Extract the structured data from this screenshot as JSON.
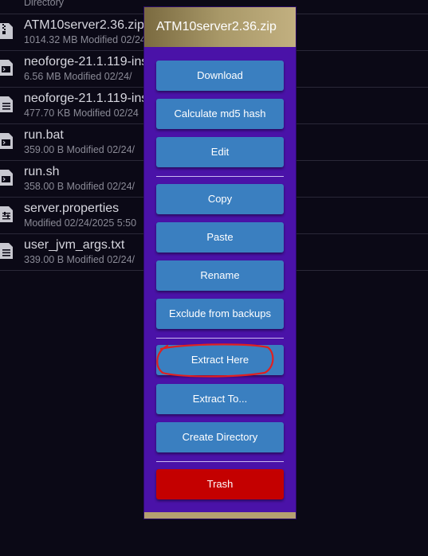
{
  "files": [
    {
      "name": "",
      "meta": "Directory",
      "icon": "folder-icon"
    },
    {
      "name": "ATM10server2.36.zip",
      "meta": "1014.32 MB Modified 02/24/",
      "icon": "zip-file-icon"
    },
    {
      "name": "neoforge-21.1.119-ins",
      "meta": "6.56 MB Modified 02/24/",
      "icon": "terminal-file-icon"
    },
    {
      "name": "neoforge-21.1.119-ins",
      "meta": "477.70 KB Modified 02/24",
      "icon": "document-file-icon"
    },
    {
      "name": "run.bat",
      "meta": "359.00 B Modified 02/24/",
      "icon": "terminal-file-icon"
    },
    {
      "name": "run.sh",
      "meta": "358.00 B Modified 02/24/",
      "icon": "terminal-file-icon"
    },
    {
      "name": "server.properties",
      "meta": "Modified 02/24/2025 5:50",
      "icon": "settings-file-icon"
    },
    {
      "name": "user_jvm_args.txt",
      "meta": "339.00 B Modified 02/24/",
      "icon": "document-file-icon"
    }
  ],
  "menu": {
    "title": "ATM10server2.36.zip",
    "items": {
      "download": "Download",
      "md5": "Calculate md5 hash",
      "edit": "Edit",
      "copy": "Copy",
      "paste": "Paste",
      "rename": "Rename",
      "exclude": "Exclude from backups",
      "extract_here": "Extract Here",
      "extract_to": "Extract To...",
      "create_dir": "Create Directory",
      "trash": "Trash"
    }
  },
  "colors": {
    "background": "#0b0916",
    "menu": "#4a12a8",
    "button": "#3a7fc0",
    "trash": "#c40000",
    "header_gold": "#b5a070",
    "annotation": "#e02020"
  }
}
